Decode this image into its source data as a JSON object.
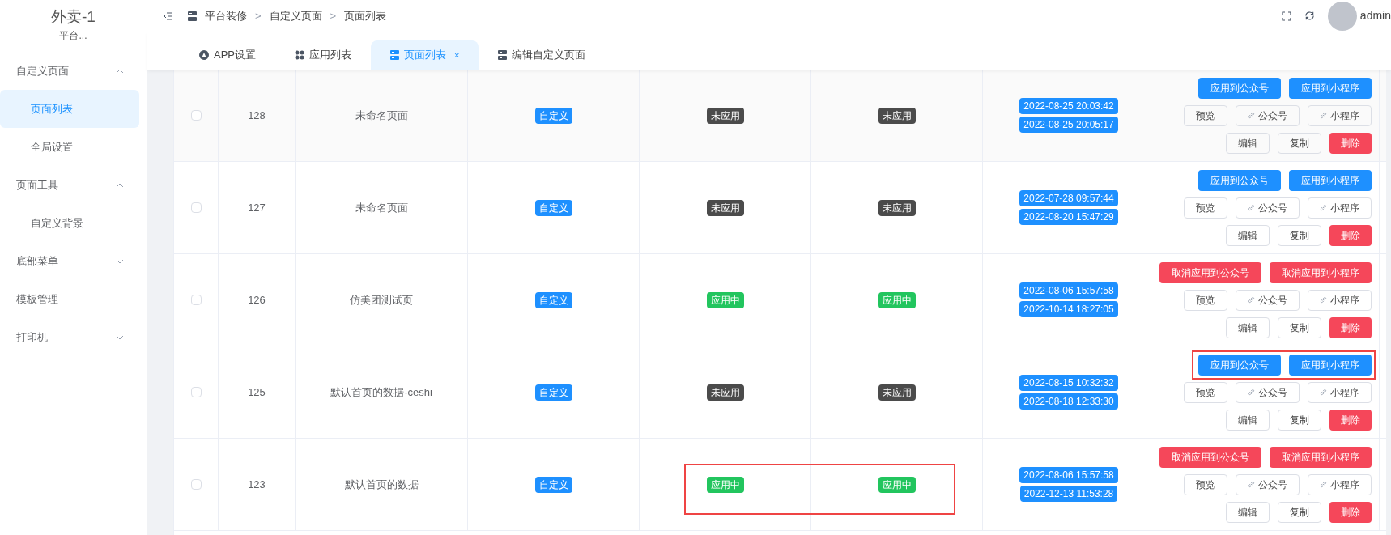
{
  "sidebar": {
    "title": "外卖-1",
    "subtitle": "平台...",
    "items": [
      {
        "label": "自定义页面",
        "expanded": true,
        "children": [
          {
            "label": "页面列表",
            "selected": true
          },
          {
            "label": "全局设置",
            "selected": false
          }
        ]
      },
      {
        "label": "页面工具",
        "expanded": true,
        "children": [
          {
            "label": "自定义背景",
            "selected": false
          }
        ]
      },
      {
        "label": "底部菜单",
        "expanded": false
      },
      {
        "label": "模板管理"
      },
      {
        "label": "打印机",
        "expanded": false
      }
    ]
  },
  "header": {
    "breadcrumb": [
      "平台装修",
      "自定义页面",
      "页面列表"
    ],
    "separator": ">",
    "user": "admin"
  },
  "tabs": [
    {
      "label": "APP设置",
      "kind": "app",
      "selected": false
    },
    {
      "label": "应用列表",
      "kind": "grid",
      "selected": false
    },
    {
      "label": "页面列表",
      "kind": "page",
      "selected": true,
      "close": "×"
    },
    {
      "label": "编辑自定义页面",
      "kind": "page",
      "selected": false
    }
  ],
  "table": {
    "rows": [
      {
        "checked": false,
        "id": "128",
        "name": "未命名页面",
        "type": "自定义",
        "status_1": {
          "label": "未应用",
          "kind": "unapplied"
        },
        "status_2": {
          "label": "未应用",
          "kind": "unapplied"
        },
        "status_highlighted": false,
        "created": "2022-08-25 20:03:42",
        "updated": "2022-08-25 20:05:17",
        "apply_buttons": [
          {
            "label": "应用到公众号",
            "kind": "apply"
          },
          {
            "label": "应用到小程序",
            "kind": "apply"
          }
        ],
        "buttons_highlighted": false,
        "actions": [
          "预览",
          "公众号",
          "小程序",
          "编辑",
          "复制",
          "删除"
        ]
      },
      {
        "checked": false,
        "id": "127",
        "name": "未命名页面",
        "type": "自定义",
        "status_1": {
          "label": "未应用",
          "kind": "unapplied"
        },
        "status_2": {
          "label": "未应用",
          "kind": "unapplied"
        },
        "status_highlighted": false,
        "created": "2022-07-28 09:57:44",
        "updated": "2022-08-20 15:47:29",
        "apply_buttons": [
          {
            "label": "应用到公众号",
            "kind": "apply"
          },
          {
            "label": "应用到小程序",
            "kind": "apply"
          }
        ],
        "buttons_highlighted": false,
        "actions": [
          "预览",
          "公众号",
          "小程序",
          "编辑",
          "复制",
          "删除"
        ]
      },
      {
        "checked": false,
        "id": "126",
        "name": "仿美团测试页",
        "type": "自定义",
        "status_1": {
          "label": "应用中",
          "kind": "applied"
        },
        "status_2": {
          "label": "应用中",
          "kind": "applied"
        },
        "status_highlighted": false,
        "created": "2022-08-06 15:57:58",
        "updated": "2022-10-14 18:27:05",
        "apply_buttons": [
          {
            "label": "取消应用到公众号",
            "kind": "cancel"
          },
          {
            "label": "取消应用到小程序",
            "kind": "cancel"
          }
        ],
        "buttons_highlighted": false,
        "actions": [
          "预览",
          "公众号",
          "小程序",
          "编辑",
          "复制",
          "删除"
        ]
      },
      {
        "checked": false,
        "id": "125",
        "name": "默认首页的数据-ceshi",
        "type": "自定义",
        "status_1": {
          "label": "未应用",
          "kind": "unapplied"
        },
        "status_2": {
          "label": "未应用",
          "kind": "unapplied"
        },
        "status_highlighted": false,
        "created": "2022-08-15 10:32:32",
        "updated": "2022-08-18 12:33:30",
        "apply_buttons": [
          {
            "label": "应用到公众号",
            "kind": "apply"
          },
          {
            "label": "应用到小程序",
            "kind": "apply"
          }
        ],
        "buttons_highlighted": true,
        "actions": [
          "预览",
          "公众号",
          "小程序",
          "编辑",
          "复制",
          "删除"
        ]
      },
      {
        "checked": false,
        "id": "123",
        "name": "默认首页的数据",
        "type": "自定义",
        "status_1": {
          "label": "应用中",
          "kind": "applied"
        },
        "status_2": {
          "label": "应用中",
          "kind": "applied"
        },
        "status_highlighted": true,
        "created": "2022-08-06 15:57:58",
        "updated": "2022-12-13 11:53:28",
        "apply_buttons": [
          {
            "label": "取消应用到公众号",
            "kind": "cancel"
          },
          {
            "label": "取消应用到小程序",
            "kind": "cancel"
          }
        ],
        "buttons_highlighted": false,
        "actions": [
          "预览",
          "公众号",
          "小程序",
          "编辑",
          "复制",
          "删除"
        ]
      }
    ]
  }
}
